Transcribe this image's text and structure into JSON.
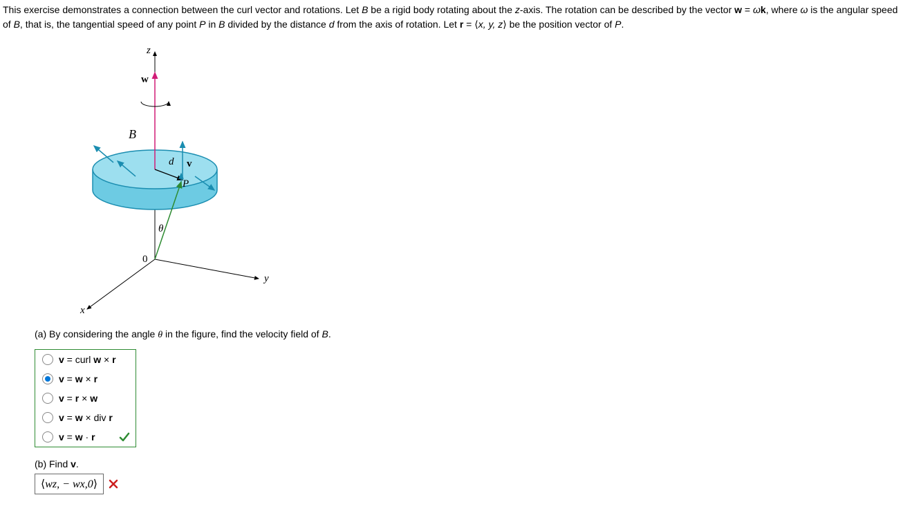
{
  "prompt": {
    "line1_pre": "This exercise demonstrates a connection between the curl vector and rotations. Let ",
    "B": "B",
    "line1_mid1": " be a rigid body rotating about the ",
    "z_axis": "z",
    "line1_mid2": "-axis. The rotation can be described by the vector ",
    "w_eq": "w",
    "eq_eq": " = ",
    "omega_k": "ω",
    "k_bold": "k",
    "line1_tail": ", where ",
    "omega2": "ω",
    "line1_end": " is the",
    "line2_pre": "angular speed of ",
    "B2": "B",
    "line2_mid1": ", that is, the tangential speed of any point ",
    "P": "P",
    "line2_mid2": " in ",
    "B3": "B",
    "line2_mid3": " divided by the distance ",
    "d": "d",
    "line2_mid4": " from the axis of rotation. Let  ",
    "r_bold": "r",
    "eq2": " = ",
    "xyz_open": "⟨",
    "xyz": "x, y, z",
    "xyz_close": "⟩",
    "line2_tail": "  be the position vector of ",
    "P2": "P",
    "period": "."
  },
  "figure": {
    "z": "z",
    "w": "w",
    "B": "B",
    "d": "d",
    "v": "v",
    "P": "P",
    "theta": "θ",
    "zero": "0",
    "y": "y",
    "x": "x"
  },
  "partA": {
    "question_pre": "(a) By considering the angle ",
    "theta": "θ",
    "question_post": " in the figure, find the velocity field of ",
    "B": "B",
    "period": ".",
    "options": [
      {
        "v": "v",
        "sep": " = ",
        "body": "curl w × r",
        "bolds": [
          "v",
          "w",
          "r"
        ],
        "fmt": "curl"
      },
      {
        "v": "v",
        "sep": " = ",
        "body": "w × r",
        "bolds": [
          "v",
          "w",
          "r"
        ],
        "fmt": "cross"
      },
      {
        "v": "v",
        "sep": " = ",
        "body": "r × w",
        "bolds": [
          "v",
          "r",
          "w"
        ],
        "fmt": "cross2"
      },
      {
        "v": "v",
        "sep": " = ",
        "body": "w × div r",
        "bolds": [
          "v",
          "w",
          "r"
        ],
        "fmt": "div"
      },
      {
        "v": "v",
        "sep": " = ",
        "body": "w · r",
        "bolds": [
          "v",
          "w",
          "r"
        ],
        "fmt": "dot"
      }
    ],
    "selected_index": 1,
    "correct": true
  },
  "partB": {
    "question_pre": "(b) Find ",
    "v": "v",
    "period": ".",
    "answer_open": "⟨",
    "answer_body": "wz, − wx,0",
    "answer_close": "⟩",
    "correct": false
  },
  "colors": {
    "green": "#2e8b32",
    "red": "#cc1e1e",
    "blue_radio": "#0077d9",
    "disk_fill": "#6dcbe3",
    "disk_stroke": "#1a8db0",
    "vector_v": "#1a8db0",
    "vector_p": "#1a8db0",
    "axis_w": "#d11c77",
    "pos_vec": "#2e8b32"
  }
}
